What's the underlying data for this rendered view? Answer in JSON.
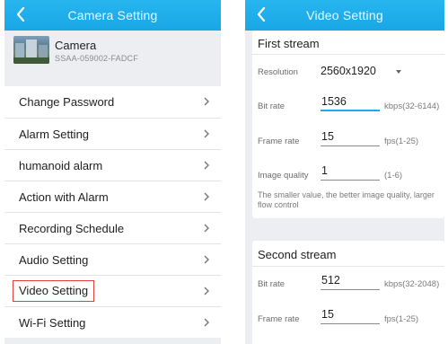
{
  "camera_setting": {
    "title": "Camera Setting",
    "camera_name": "Camera",
    "camera_uid": "SSAA-059002-FADCF",
    "menu": [
      {
        "label": "Change Password"
      },
      {
        "label": "Alarm Setting"
      },
      {
        "label": "humanoid alarm"
      },
      {
        "label": "Action with Alarm"
      },
      {
        "label": "Recording Schedule"
      },
      {
        "label": "Audio Setting"
      },
      {
        "label": "Video Setting",
        "highlighted": true
      },
      {
        "label": "Wi-Fi Setting"
      }
    ]
  },
  "video_setting": {
    "title": "Video Setting",
    "first_stream": {
      "title": "First stream",
      "resolution_label": "Resolution",
      "resolution_value": "2560x1920",
      "bitrate_label": "Bit rate",
      "bitrate_value": "1536",
      "bitrate_unit": "kbps(32-6144)",
      "framerate_label": "Frame rate",
      "framerate_value": "15",
      "framerate_unit": "fps(1-25)",
      "quality_label": "Image quality",
      "quality_value": "1",
      "quality_unit": "(1-6)",
      "note": "The smaller value, the better image quality, larger flow control"
    },
    "second_stream": {
      "title": "Second stream",
      "bitrate_label": "Bit rate",
      "bitrate_value": "512",
      "bitrate_unit": "kbps(32-2048)",
      "framerate_label": "Frame rate",
      "framerate_value": "15",
      "framerate_unit": "fps(1-25)"
    }
  },
  "colors": {
    "header": "#1fadea",
    "background": "#eceef1",
    "accent_underline": "#23a8e6",
    "highlight_box": "#e0403d"
  },
  "icons": {
    "back": "chevron-left-icon",
    "row_arrow": "chevron-right-icon",
    "dropdown": "caret-down-icon"
  }
}
